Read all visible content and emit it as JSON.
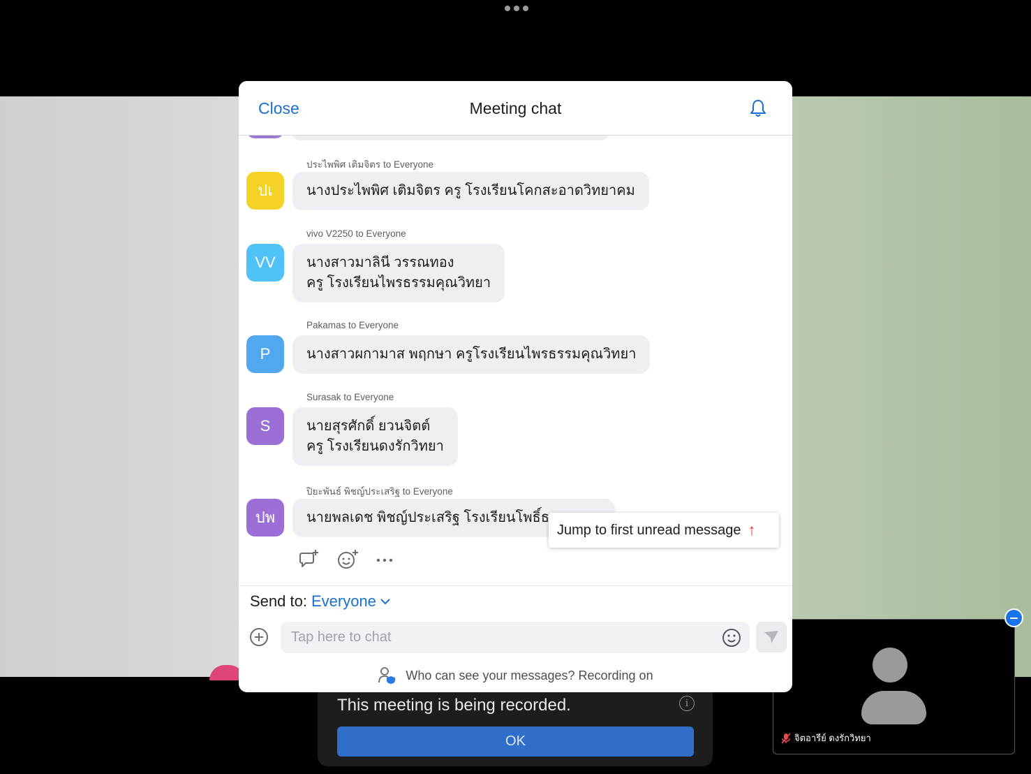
{
  "background": {
    "recording_banner": {
      "text": "This meeting is being recorded.",
      "ok_label": "OK"
    },
    "self_view": {
      "name": "จิตอารีย์ ดงรักวิทยา"
    }
  },
  "modal": {
    "close_label": "Close",
    "title": "Meeting chat",
    "messages": [
      {
        "meta": "ประไพพิศ เติมจิตร to Everyone",
        "avatar": "ปเ",
        "avatar_color": "#f5d226",
        "text": "นางประไพพิศ เติมจิตร ครู โรงเรียนโคกสะอาดวิทยาคม"
      },
      {
        "meta": "vivo V2250 to Everyone",
        "avatar": "VV",
        "avatar_color": "#4fc3f7",
        "text": "นางสาวมาลินี  วรรณทอง\nครู โรงเรียนไพรธรรมคุณวิทยา"
      },
      {
        "meta": "Pakamas to Everyone",
        "avatar": "P",
        "avatar_color": "#52a8ef",
        "text": "นางสาวผกามาส พฤกษา ครูโรงเรียนไพรธรรมคุณวิทยา"
      },
      {
        "meta": "Surasak to Everyone",
        "avatar": "S",
        "avatar_color": "#9b6fd6",
        "text": "นายสุรศักดิ์ ยวนจิตต์\nครู โรงเรียนดงรักวิทยา"
      },
      {
        "meta": "ปิยะพันธ์ พิชญ์ประเสริฐ to Everyone",
        "avatar": "ปพ",
        "avatar_color": "#9b6fd6",
        "text": "นายพลเดช พิชญ์ประเสริฐ โรงเรียนโพธิ์ธา"
      }
    ],
    "jump_label": "Jump to first unread message",
    "send_to": {
      "label": "Send to:",
      "target": "Everyone"
    },
    "input": {
      "placeholder": "Tap here to chat",
      "value": ""
    },
    "privacy_text": "Who can see your messages? Recording on"
  }
}
